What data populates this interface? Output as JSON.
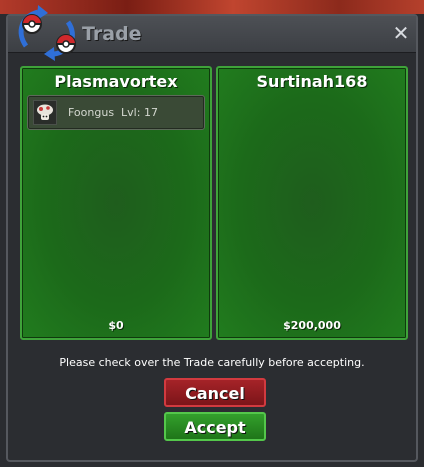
{
  "window": {
    "title": "Trade",
    "close_symbol": "✕",
    "icon": "trade-exchange-icon",
    "close_icon": "close-icon"
  },
  "left_panel": {
    "player": "Plasmavortex",
    "money": "$0",
    "items": [
      {
        "icon": "foongus-icon",
        "label": "Foongus  Lvl: 17"
      }
    ]
  },
  "right_panel": {
    "player": "Surtinah168",
    "money": "$200,000",
    "items": []
  },
  "notice": "Please check over the Trade carefully before accepting.",
  "buttons": {
    "cancel": "Cancel",
    "accept": "Accept"
  },
  "colors": {
    "panel_green": "#1c6a1a",
    "panel_border": "#3fa33a",
    "cancel_red": "#a52328",
    "accept_green": "#33a02c"
  }
}
